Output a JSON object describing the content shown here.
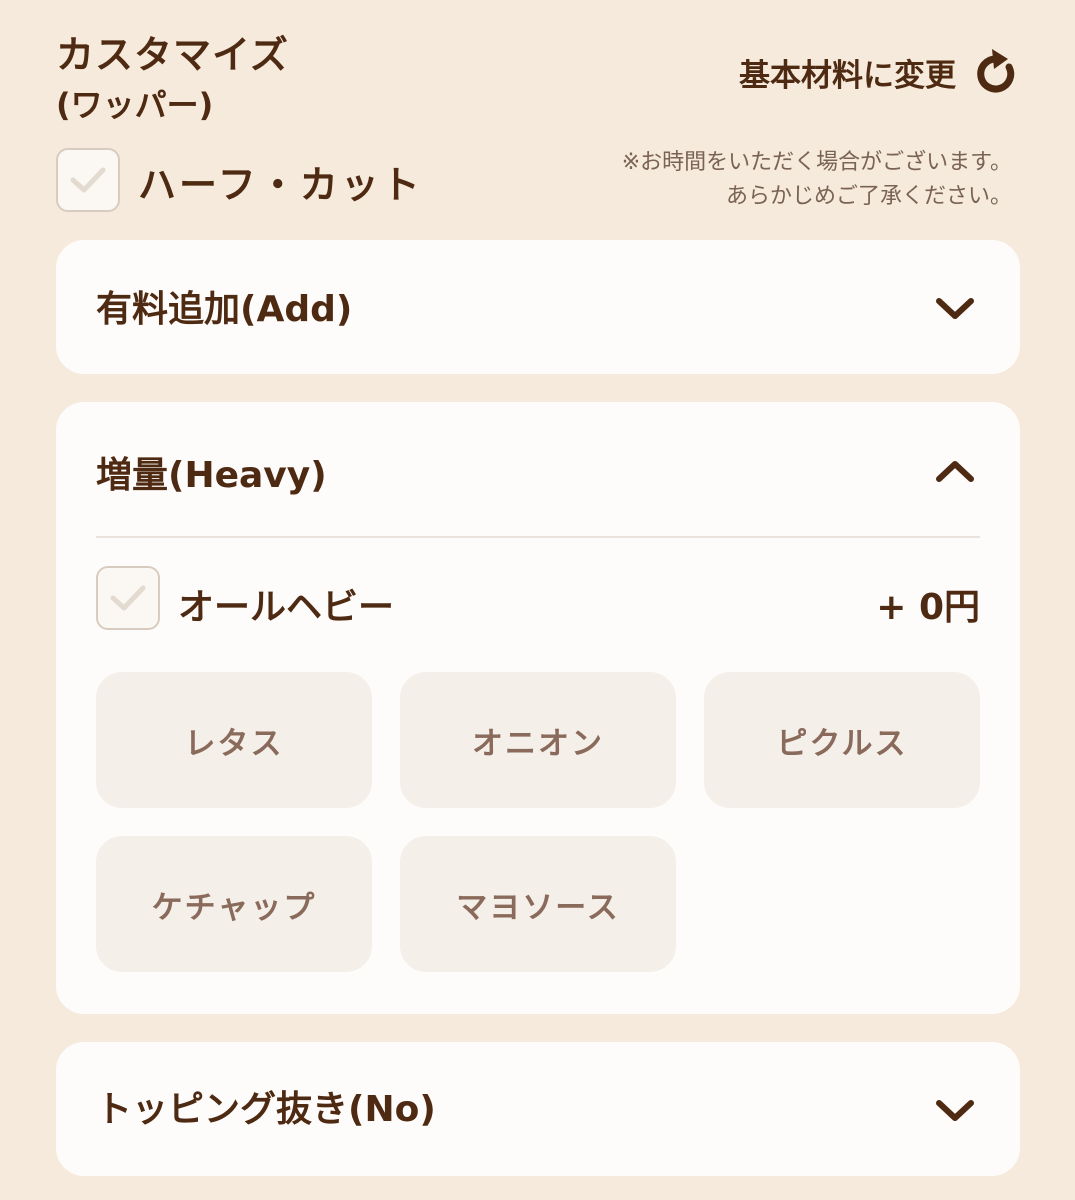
{
  "header": {
    "title": "カスタマイズ",
    "subtitle": "(ワッパー)",
    "reset_label": "基本材料に変更"
  },
  "half_cut": {
    "label": "ハーフ・カット",
    "checked": false,
    "notice_line1": "※お時間をいただく場合がございます。",
    "notice_line2": "あらかじめご了承ください。"
  },
  "sections": [
    {
      "title": "有料追加(Add)",
      "expanded": false
    },
    {
      "title": "増量(Heavy)",
      "expanded": true,
      "all_heavy": {
        "label": "オールヘビー",
        "price": "+ 0円",
        "checked": false
      },
      "options": [
        "レタス",
        "オニオン",
        "ピクルス",
        "ケチャップ",
        "マヨソース"
      ]
    },
    {
      "title": "トッピング抜き(No)",
      "expanded": false
    }
  ],
  "icons": {
    "reset": "refresh-icon",
    "collapsed": "chevron-down-icon",
    "expanded": "chevron-up-icon",
    "check": "check-icon"
  },
  "colors": {
    "background": "#f5eadb",
    "card": "#fdfcfa",
    "text_dark": "#4f2a12",
    "option_bg": "#f4efe9",
    "option_text": "#8a6a5a",
    "check_mark": "#e3dad0"
  }
}
